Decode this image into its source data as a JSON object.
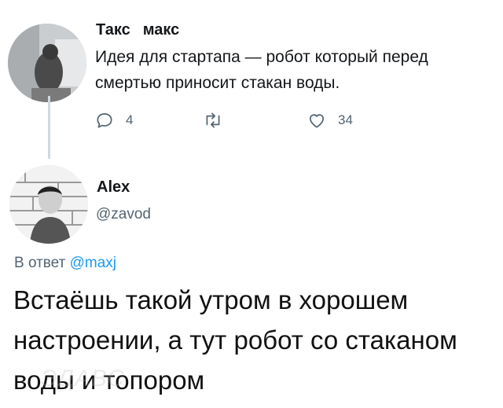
{
  "tweet1": {
    "name": "Такс",
    "handle": "макс",
    "text": "Идея для стартапа — робот который перед смертью приносит стакан воды.",
    "reply_count": "4",
    "retweet_count": "",
    "like_count": "34"
  },
  "tweet2": {
    "name": "Alex",
    "handle": "@zavod",
    "reply_prefix": "В ответ",
    "reply_mention": "@maxj",
    "text": "Встаёшь такой утром в хорошем настроении, а тут робот со стаканом воды и топором"
  },
  "watermark": "ЭДАВС",
  "icons": [
    "reply-icon",
    "retweet-icon",
    "like-icon"
  ],
  "colors": {
    "mention": "#1d9bf0",
    "muted": "#536471",
    "text": "#14171a"
  }
}
